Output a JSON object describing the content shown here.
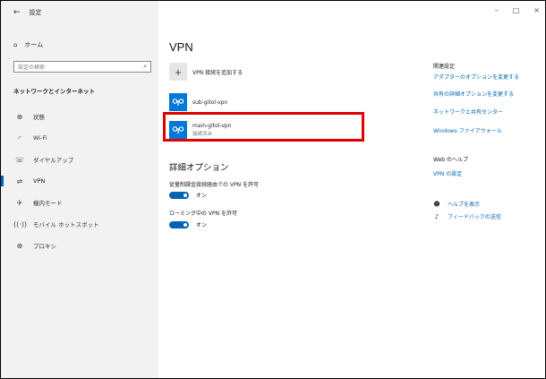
{
  "window": {
    "title": "設定",
    "controls": {
      "minimize": "–",
      "maximize": "□",
      "close": "×"
    }
  },
  "sidebar": {
    "home": "ホーム",
    "search_placeholder": "設定の検索",
    "section_title": "ネットワークとインターネット",
    "items": [
      {
        "label": "状態",
        "icon": "status-icon"
      },
      {
        "label": "Wi-Fi",
        "icon": "wifi-icon"
      },
      {
        "label": "ダイヤルアップ",
        "icon": "dialup-icon"
      },
      {
        "label": "VPN",
        "icon": "vpn-icon",
        "active": true
      },
      {
        "label": "機内モード",
        "icon": "airplane-icon"
      },
      {
        "label": "モバイル ホットスポット",
        "icon": "hotspot-icon"
      },
      {
        "label": "プロキシ",
        "icon": "globe-icon"
      }
    ]
  },
  "main": {
    "title": "VPN",
    "add_label": "VPN 接続を追加する",
    "connections": [
      {
        "name": "sub-gitol-vpn",
        "status": ""
      },
      {
        "name": "main-gitol-vpn",
        "status": "接続済み"
      }
    ],
    "advanced": {
      "title": "詳細オプション",
      "options": [
        {
          "label": "従量制課金接続経由での VPN を許可",
          "state": "オン"
        },
        {
          "label": "ローミング中の VPN を許可",
          "state": "オン"
        }
      ]
    }
  },
  "related": {
    "title": "関連設定",
    "links": [
      "アダプターのオプションを変更する",
      "共有の詳細オプションを変更する",
      "ネットワークと共有センター",
      "Windows ファイアウォール"
    ]
  },
  "web_help": {
    "title": "Web のヘルプ",
    "link": "VPN の設定"
  },
  "help_actions": {
    "help": "ヘルプを表示",
    "feedback": "フィードバックの送信"
  },
  "colors": {
    "accent": "#0063b1",
    "link": "#0066b4",
    "highlight": "#e00000",
    "vpn_icon_bg": "#0078d7"
  }
}
